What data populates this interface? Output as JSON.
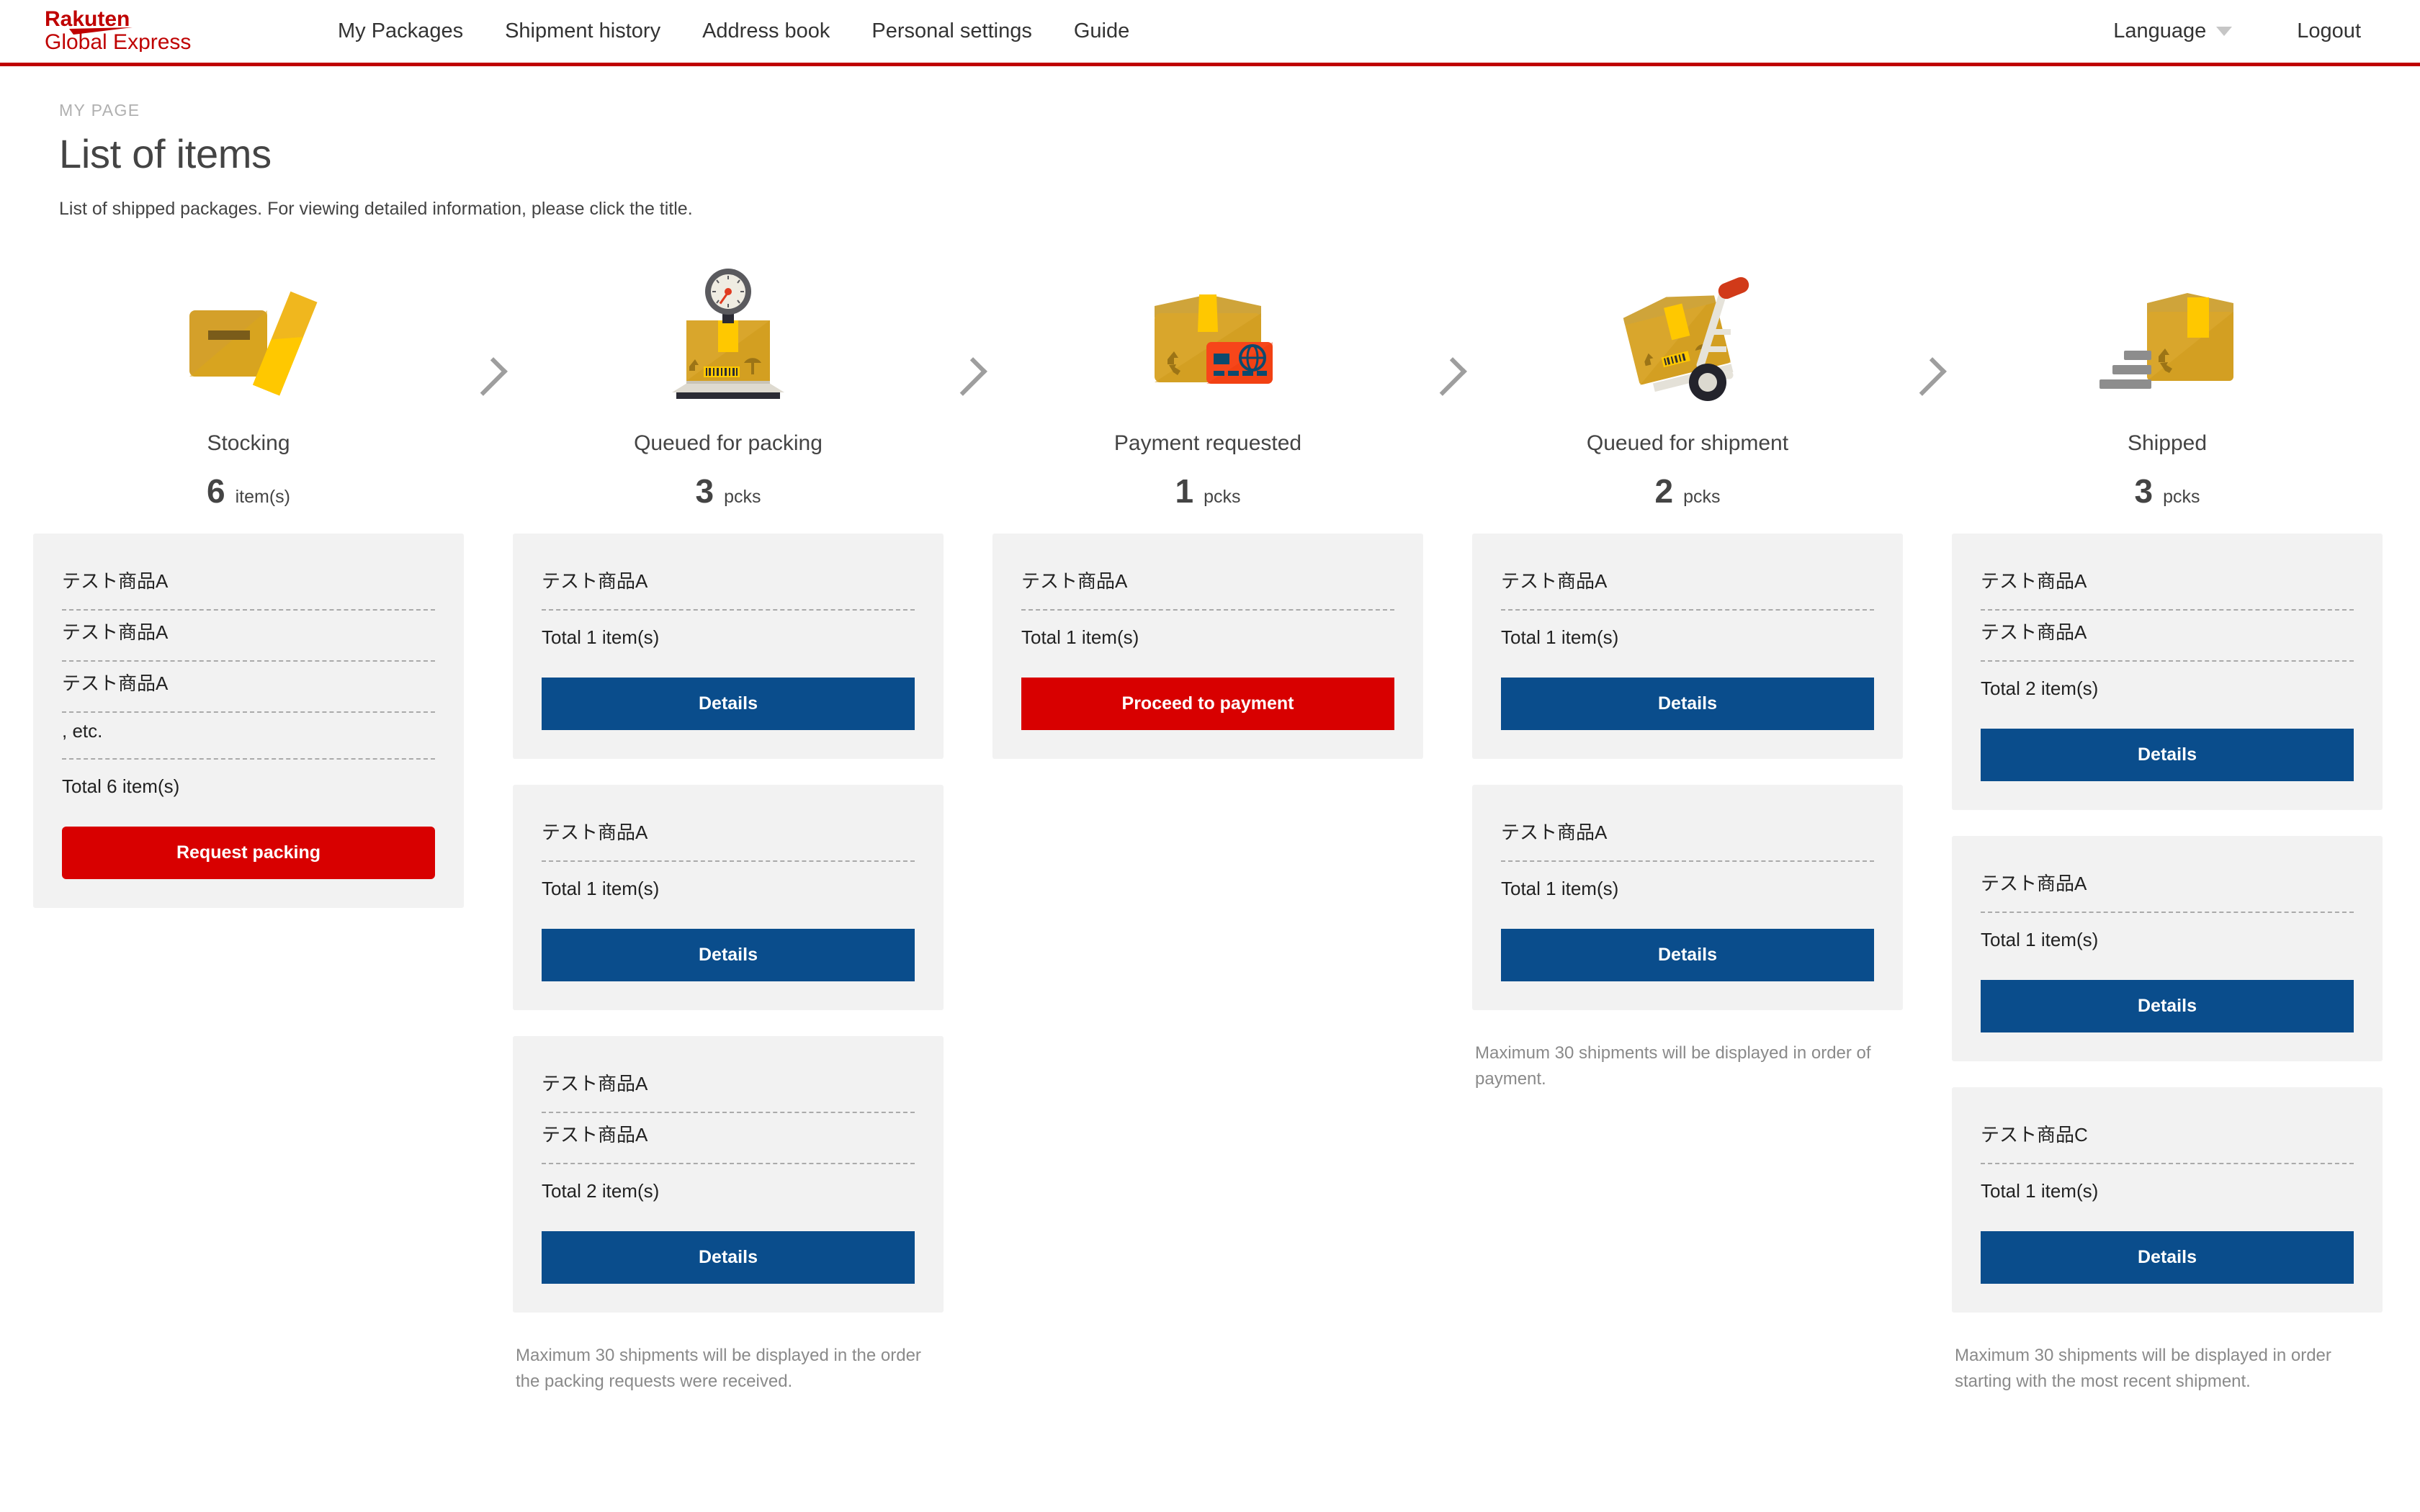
{
  "brand": {
    "line1": "Rakuten",
    "line2": "Global Express",
    "color": "#bf0000"
  },
  "nav": {
    "items": [
      {
        "label": "My Packages"
      },
      {
        "label": "Shipment history"
      },
      {
        "label": "Address book"
      },
      {
        "label": "Personal settings"
      },
      {
        "label": "Guide"
      }
    ],
    "language": "Language",
    "logout": "Logout"
  },
  "page": {
    "eyebrow": "MY PAGE",
    "title": "List of items",
    "subtitle": "List of shipped packages. For viewing detailed information, please click the title."
  },
  "colors": {
    "primary_red": "#d80000",
    "brand_red": "#bf0000",
    "details_blue": "#0a4d8c",
    "card_bg": "#f2f2f2",
    "note_gray": "#8a8a8a"
  },
  "steps": [
    {
      "id": "stocking",
      "icon": "box-with-lid-icon",
      "label": "Stocking",
      "count": "6",
      "unit": "item(s)",
      "note": "",
      "cards": [
        {
          "items": [
            "テスト商品A",
            "テスト商品A",
            "テスト商品A",
            ", etc."
          ],
          "total": "Total 6 item(s)",
          "button": {
            "label": "Request packing",
            "style": "red-round"
          }
        }
      ]
    },
    {
      "id": "queued-for-packing",
      "icon": "box-on-scale-icon",
      "label": "Queued for packing",
      "count": "3",
      "unit": "pcks",
      "note": "Maximum 30 shipments will be displayed in the order the packing requests were received.",
      "cards": [
        {
          "items": [
            "テスト商品A"
          ],
          "total": "Total 1 item(s)",
          "button": {
            "label": "Details",
            "style": "blue"
          }
        },
        {
          "items": [
            "テスト商品A"
          ],
          "total": "Total 1 item(s)",
          "button": {
            "label": "Details",
            "style": "blue"
          }
        },
        {
          "items": [
            "テスト商品A",
            "テスト商品A"
          ],
          "total": "Total 2 item(s)",
          "button": {
            "label": "Details",
            "style": "blue"
          }
        }
      ]
    },
    {
      "id": "payment-requested",
      "icon": "box-with-credit-card-icon",
      "label": "Payment requested",
      "count": "1",
      "unit": "pcks",
      "note": "",
      "cards": [
        {
          "items": [
            "テスト商品A"
          ],
          "total": "Total 1 item(s)",
          "button": {
            "label": "Proceed to payment",
            "style": "red"
          }
        }
      ]
    },
    {
      "id": "queued-for-shipment",
      "icon": "hand-truck-with-box-icon",
      "label": "Queued for shipment",
      "count": "2",
      "unit": "pcks",
      "note": "Maximum 30 shipments will be displayed in order of payment.",
      "cards": [
        {
          "items": [
            "テスト商品A"
          ],
          "total": "Total 1 item(s)",
          "button": {
            "label": "Details",
            "style": "blue"
          }
        },
        {
          "items": [
            "テスト商品A"
          ],
          "total": "Total 1 item(s)",
          "button": {
            "label": "Details",
            "style": "blue"
          }
        }
      ]
    },
    {
      "id": "shipped",
      "icon": "box-in-motion-icon",
      "label": "Shipped",
      "count": "3",
      "unit": "pcks",
      "note": "Maximum 30 shipments will be displayed in order starting with the most recent shipment.",
      "cards": [
        {
          "items": [
            "テスト商品A",
            "テスト商品A"
          ],
          "total": "Total 2 item(s)",
          "button": {
            "label": "Details",
            "style": "blue"
          }
        },
        {
          "items": [
            "テスト商品A"
          ],
          "total": "Total 1 item(s)",
          "button": {
            "label": "Details",
            "style": "blue"
          }
        },
        {
          "items": [
            "テスト商品C"
          ],
          "total": "Total 1 item(s)",
          "button": {
            "label": "Details",
            "style": "blue"
          }
        }
      ]
    }
  ]
}
